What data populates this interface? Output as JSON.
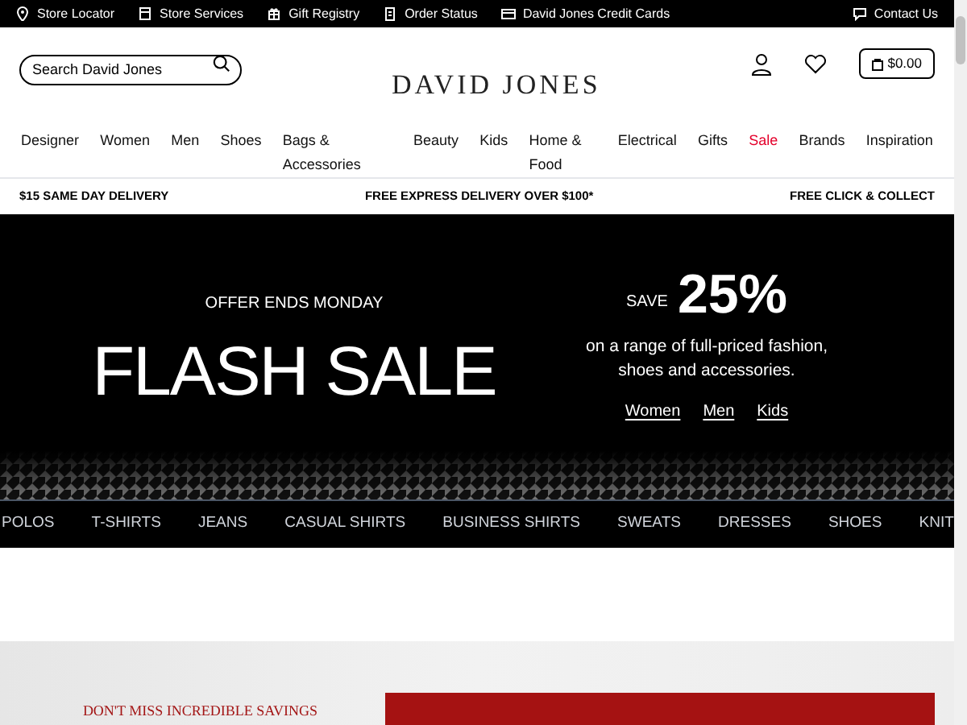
{
  "utility_bar": {
    "links": [
      {
        "label": "Store Locator",
        "kind": "pin"
      },
      {
        "label": "Store Services",
        "kind": "store"
      },
      {
        "label": "Gift Registry",
        "kind": "gift"
      },
      {
        "label": "Order Status",
        "kind": "doc"
      },
      {
        "label": "David Jones Credit Cards",
        "kind": "card"
      }
    ],
    "contact": {
      "label": "Contact Us",
      "kind": "chat"
    }
  },
  "header": {
    "search": {
      "placeholder": "Search David Jones"
    },
    "logo": "DAVID JONES",
    "cart": "$0.00"
  },
  "nav": [
    {
      "label": "Designer",
      "color": "#111111"
    },
    {
      "label": "Women",
      "color": "#111111"
    },
    {
      "label": "Men",
      "color": "#111111"
    },
    {
      "label": "Shoes",
      "color": "#111111"
    },
    {
      "label": "Bags & Accessories",
      "color": "#111111"
    },
    {
      "label": "Beauty",
      "color": "#111111"
    },
    {
      "label": "Kids",
      "color": "#111111"
    },
    {
      "label": "Home & Food",
      "color": "#111111"
    },
    {
      "label": "Electrical",
      "color": "#111111"
    },
    {
      "label": "Gifts",
      "color": "#111111"
    },
    {
      "label": "Sale",
      "color": "#e4002b"
    },
    {
      "label": "Brands",
      "color": "#111111"
    },
    {
      "label": "Inspiration",
      "color": "#111111"
    }
  ],
  "delivery_bar": [
    "$15 SAME DAY DELIVERY",
    "FREE EXPRESS DELIVERY OVER $100*",
    "FREE CLICK & COLLECT"
  ],
  "hero": {
    "eyebrow": "OFFER ENDS MONDAY",
    "headline": "FLASH SALE",
    "save_label": "SAVE",
    "save_amount": "25%",
    "description": "on a range of full-priced fashion, shoes and accessories.",
    "links": [
      "Women",
      "Men",
      "Kids"
    ]
  },
  "categories": [
    "POLOS",
    "T-SHIRTS",
    "JEANS",
    "CASUAL SHIRTS",
    "BUSINESS SHIRTS",
    "SWEATS",
    "DRESSES",
    "SHOES",
    "KNIT"
  ],
  "promo": {
    "heading": "DON'T MISS INCREDIBLE SAVINGS"
  }
}
